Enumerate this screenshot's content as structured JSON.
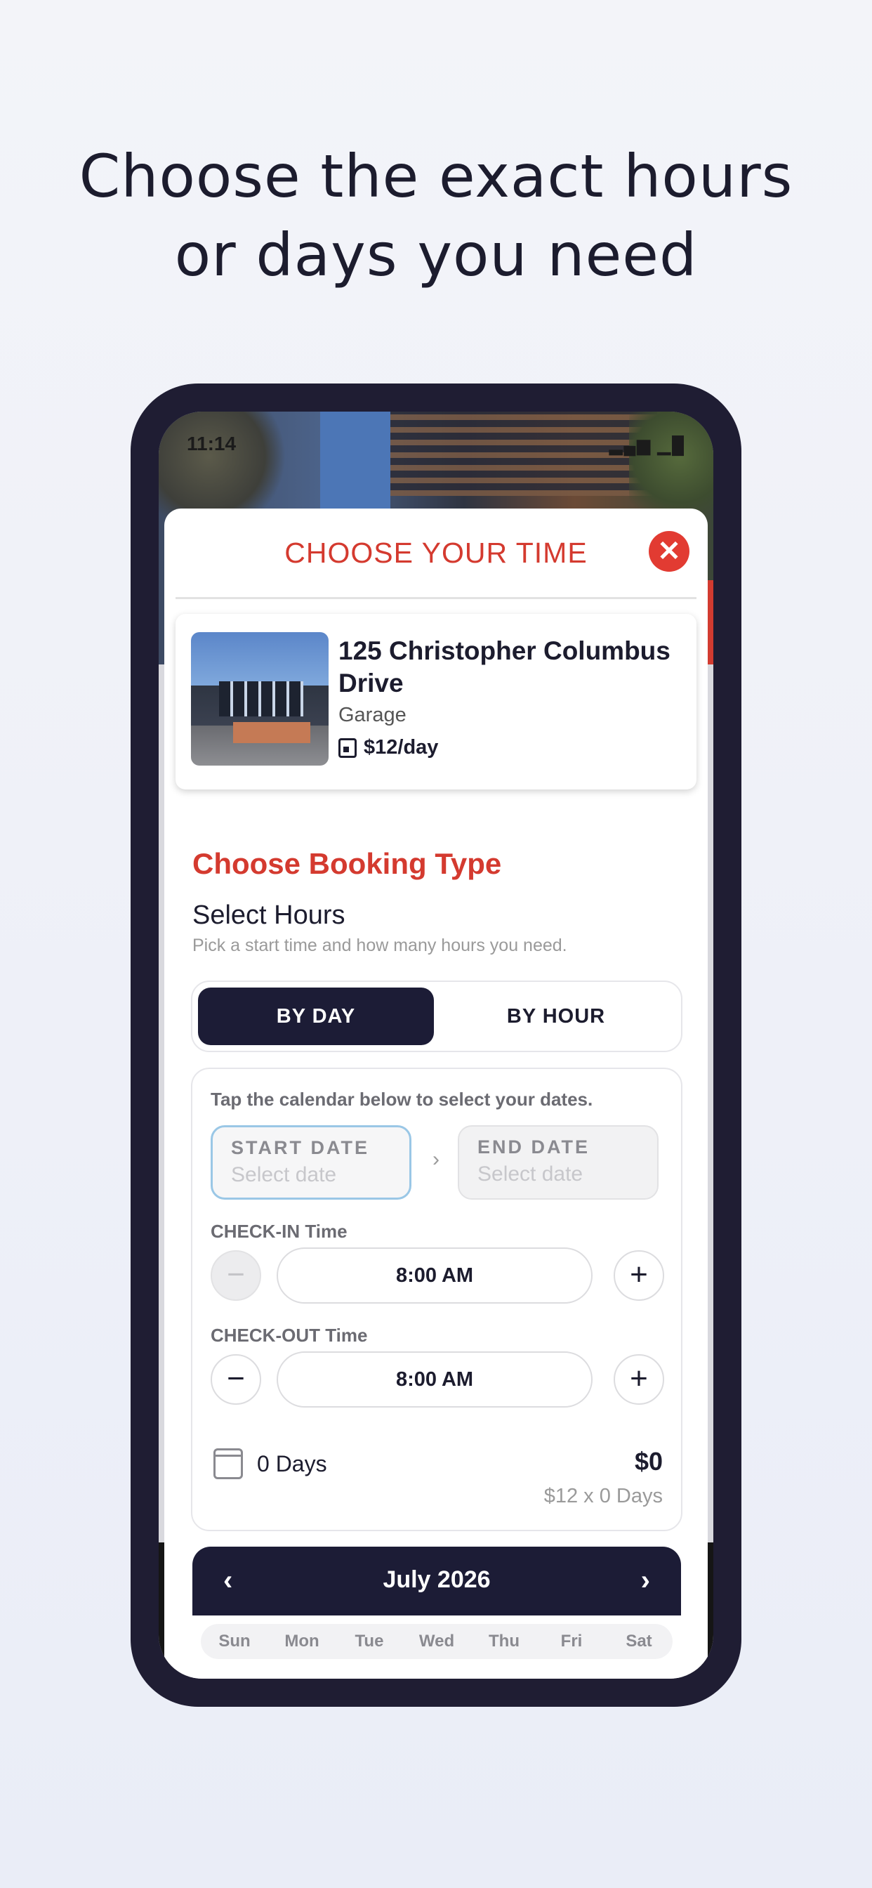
{
  "headline": {
    "line1": "Choose the exact hours",
    "line2": "or days you need"
  },
  "status_bar": {
    "time": "11:14",
    "icons": "▂▄▆ ▁█"
  },
  "sheet": {
    "title": "CHOOSE YOUR TIME",
    "close_symbol": "✕"
  },
  "listing": {
    "name": "125 Christopher Columbus Drive",
    "type": "Garage",
    "price": "$12/day"
  },
  "booking": {
    "section_title": "Choose Booking Type",
    "heading": "Select Hours",
    "subheading": "Pick a start time and how many hours you need.",
    "toggle": {
      "by_day": "BY DAY",
      "by_hour": "BY HOUR",
      "selected": "BY DAY"
    }
  },
  "dates": {
    "hint": "Tap the calendar below to select your dates.",
    "start_label": "START DATE",
    "start_placeholder": "Select date",
    "end_label": "END DATE",
    "end_placeholder": "Select date",
    "arrow": "›"
  },
  "checkin": {
    "label": "CHECK-IN Time",
    "value": "8:00 AM",
    "minus": "−",
    "plus": "+"
  },
  "checkout": {
    "label": "CHECK-OUT Time",
    "value": "8:00 AM",
    "minus": "−",
    "plus": "+"
  },
  "summary": {
    "days": "0 Days",
    "total": "$0",
    "calc": "$12 x 0 Days"
  },
  "calendar": {
    "month": "July 2026",
    "prev": "‹",
    "next": "›",
    "weekdays": [
      "Sun",
      "Mon",
      "Tue",
      "Wed",
      "Thu",
      "Fri",
      "Sat"
    ]
  },
  "colors": {
    "accent_red": "#d43a2f",
    "navy": "#1c1c36",
    "phone_frame": "#1f1d33"
  }
}
